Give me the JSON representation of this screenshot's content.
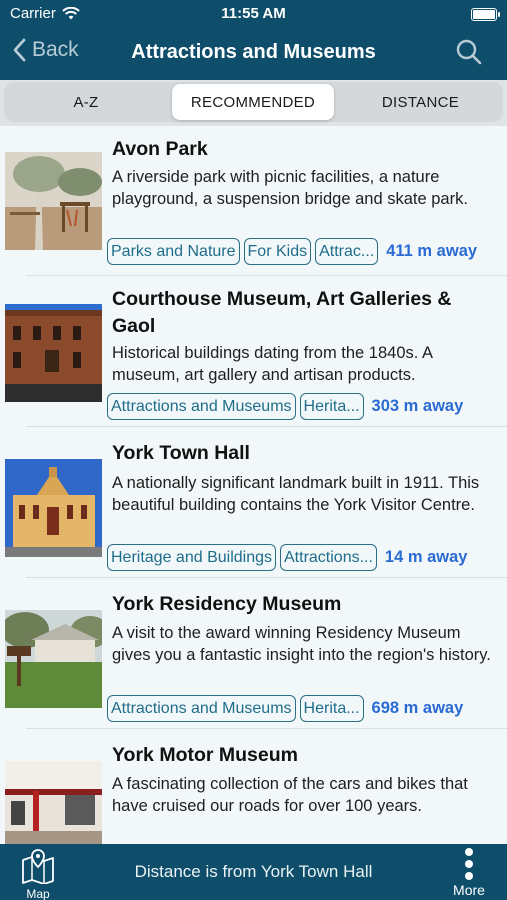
{
  "status": {
    "carrier": "Carrier",
    "time": "11:55 AM"
  },
  "nav": {
    "back_label": "Back",
    "title": "Attractions and Museums"
  },
  "segments": [
    "A-Z",
    "RECOMMENDED",
    "DISTANCE"
  ],
  "items": [
    {
      "title": "Avon Park",
      "description": "A riverside park with picnic facilities, a nature playground, a suspension bridge and skate park.",
      "tags": [
        "Parks and Nature",
        "For Kids",
        "Attrac..."
      ],
      "distance": "411 m away"
    },
    {
      "title": "Courthouse Museum, Art Galleries & Gaol",
      "description": "Historical buildings dating from the 1840s. A museum, art gallery and artisan products.",
      "tags": [
        "Attractions and Museums",
        "Herita..."
      ],
      "distance": "303 m away"
    },
    {
      "title": "York Town Hall",
      "description": "A nationally significant landmark built in 1911. This beautiful building contains the York Visitor Centre.",
      "tags": [
        "Heritage and Buildings",
        "Attractions..."
      ],
      "distance": "14 m away"
    },
    {
      "title": "York Residency Museum",
      "description": "A visit to the award winning Residency Museum gives you a fantastic insight into the region's history.",
      "tags": [
        "Attractions and Museums",
        "Herita..."
      ],
      "distance": "698 m away"
    },
    {
      "title": "York Motor Museum",
      "description": "A fascinating collection of the cars and bikes that have cruised our roads for over 100 years.",
      "tags": [],
      "distance": ""
    }
  ],
  "bottom": {
    "map_label": "Map",
    "info": "Distance is from York Town Hall",
    "more_label": "More"
  },
  "colors": {
    "bar": "#0e4e6b",
    "tag_border": "#2c6f87",
    "distance": "#2a6bd3"
  }
}
